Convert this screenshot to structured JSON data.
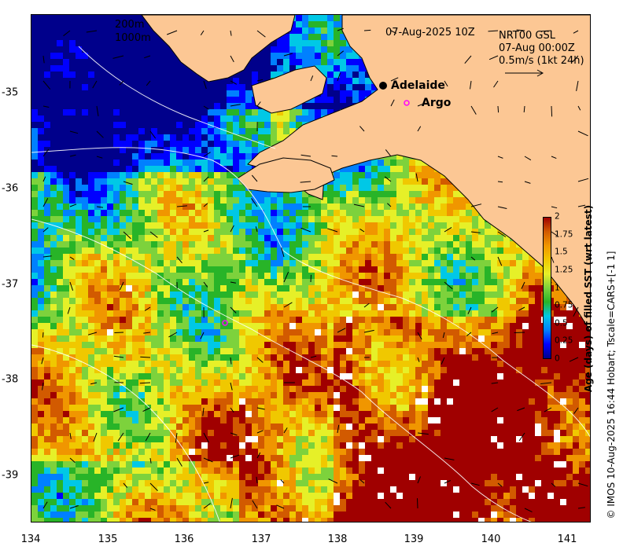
{
  "header": {
    "datetime": "07-Aug-2025 10Z",
    "product": "NRT00 GSL",
    "current_time": "07-Aug 00:00Z",
    "current_scale": "0.5m/s (1kt 24h)"
  },
  "isobaths": [
    "200m",
    "1000m"
  ],
  "places": [
    {
      "name": "Adelaide",
      "marker": "filled-black-circle"
    },
    {
      "name": "Argo",
      "marker": "open-magenta-circle"
    }
  ],
  "x_axis": {
    "ticks": [
      "134",
      "135",
      "136",
      "137",
      "138",
      "139",
      "140",
      "141"
    ],
    "range": [
      134,
      141.3
    ]
  },
  "y_axis": {
    "ticks": [
      "-35",
      "-36",
      "-37",
      "-38",
      "-39"
    ],
    "range": [
      -39.5,
      -34.2
    ]
  },
  "colorbar": {
    "label": "Age (days) of filled SST (wrt latest)",
    "ticks": [
      "0",
      "0.25",
      "0.5",
      "0.75",
      "1",
      "1.25",
      "1.5",
      "1.75",
      "2"
    ],
    "range": [
      0,
      2
    ],
    "colors": [
      "#00008b",
      "#0000ff",
      "#0080ff",
      "#00c8e6",
      "#28b428",
      "#7dd23c",
      "#e6f028",
      "#f0c800",
      "#f09600",
      "#d25a00",
      "#a00000"
    ]
  },
  "colors": {
    "land": "#fcc794",
    "no_data": "#ffffff",
    "coast": "#000000",
    "contour": "#ffffff",
    "argo": "#ff00ff"
  },
  "credit": "© IMOS 10-Aug-2025 16:44 Hobart; Tscale=CARS+[-1 1]"
}
